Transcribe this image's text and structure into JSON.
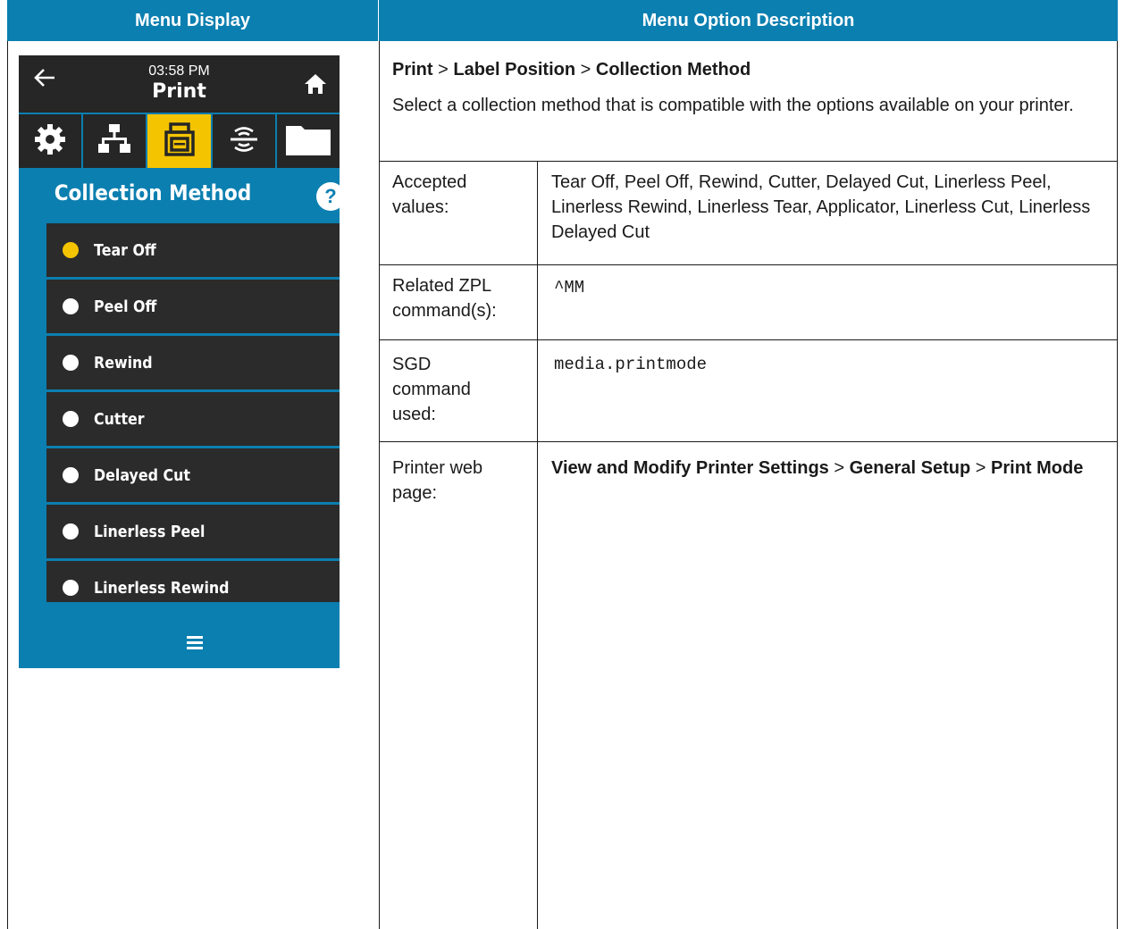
{
  "header": {
    "left": "Menu Display",
    "right": "Menu Option Description"
  },
  "device": {
    "time": "03:58 PM",
    "title": "Print",
    "tabs": [
      "settings-icon",
      "network-icon",
      "print-icon",
      "connectivity-icon",
      "folder-icon"
    ],
    "active_tab": "print-icon",
    "screen_title": "Collection Method",
    "help": "?",
    "items": [
      {
        "label": "Tear Off",
        "selected": true
      },
      {
        "label": "Peel Off",
        "selected": false
      },
      {
        "label": "Rewind",
        "selected": false
      },
      {
        "label": "Cutter",
        "selected": false
      },
      {
        "label": "Delayed Cut",
        "selected": false
      },
      {
        "label": "Linerless Peel",
        "selected": false
      },
      {
        "label": "Linerless Rewind",
        "selected": false
      }
    ],
    "colors": {
      "screen": "#0b7fb0",
      "bar": "#262626",
      "accent": "#f5c400"
    }
  },
  "description": {
    "breadcrumb": [
      "Print",
      "Label Position",
      "Collection Method"
    ],
    "separator": ">",
    "intro": "Select a collection method that is compatible with the options available on your printer.",
    "rows": [
      {
        "label": "Accepted values:",
        "value": "Tear Off, Peel Off, Rewind, Cutter, Delayed Cut, Linerless Peel, Linerless Rewind, Linerless Tear, Applicator, Linerless Cut, Linerless Delayed Cut"
      },
      {
        "label": "Related ZPL command(s):",
        "value": "^MM"
      },
      {
        "label": "SGD command used:",
        "value": "media.printmode"
      },
      {
        "label": "Printer web page:",
        "value_parts": [
          "View and Modify Printer Settings",
          "General Setup",
          "Print Mode"
        ]
      }
    ]
  }
}
